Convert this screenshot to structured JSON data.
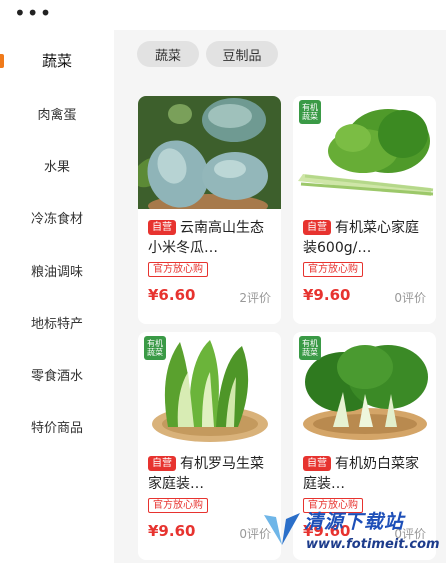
{
  "sidebar": {
    "items": [
      {
        "label": "蔬菜",
        "active": true
      },
      {
        "label": "肉禽蛋",
        "active": false
      },
      {
        "label": "水果",
        "active": false
      },
      {
        "label": "冷冻食材",
        "active": false
      },
      {
        "label": "粮油调味",
        "active": false
      },
      {
        "label": "地标特产",
        "active": false
      },
      {
        "label": "零食酒水",
        "active": false
      },
      {
        "label": "特价商品",
        "active": false
      }
    ]
  },
  "chips": [
    "蔬菜",
    "豆制品"
  ],
  "products": [
    {
      "self_label": "自营",
      "title": "云南高山生态小米冬瓜…",
      "tag": "官方放心购",
      "price": "¥6.60",
      "reviews": "2评价",
      "organic": false,
      "image": "winter-melon"
    },
    {
      "self_label": "自营",
      "title": "有机菜心家庭装600g/…",
      "tag": "官方放心购",
      "price": "¥9.60",
      "reviews": "0评价",
      "organic": true,
      "organic_label": "有机\n蔬菜",
      "image": "choy-sum"
    },
    {
      "self_label": "自营",
      "title": "有机罗马生菜家庭装…",
      "tag": "官方放心购",
      "price": "¥9.60",
      "reviews": "0评价",
      "organic": true,
      "organic_label": "有机\n蔬菜",
      "image": "romaine-lettuce"
    },
    {
      "self_label": "自营",
      "title": "有机奶白菜家庭装…",
      "tag": "官方放心购",
      "price": "¥9.60",
      "reviews": "0评价",
      "organic": true,
      "organic_label": "有机\n蔬菜",
      "image": "bok-choy"
    }
  ],
  "watermark": {
    "title": "清源下载站",
    "url": "www.fotimeit.com"
  },
  "colors": {
    "accent_red": "#e7332f",
    "active_orange": "#f07a1a",
    "organic_green": "#3a9a46"
  }
}
